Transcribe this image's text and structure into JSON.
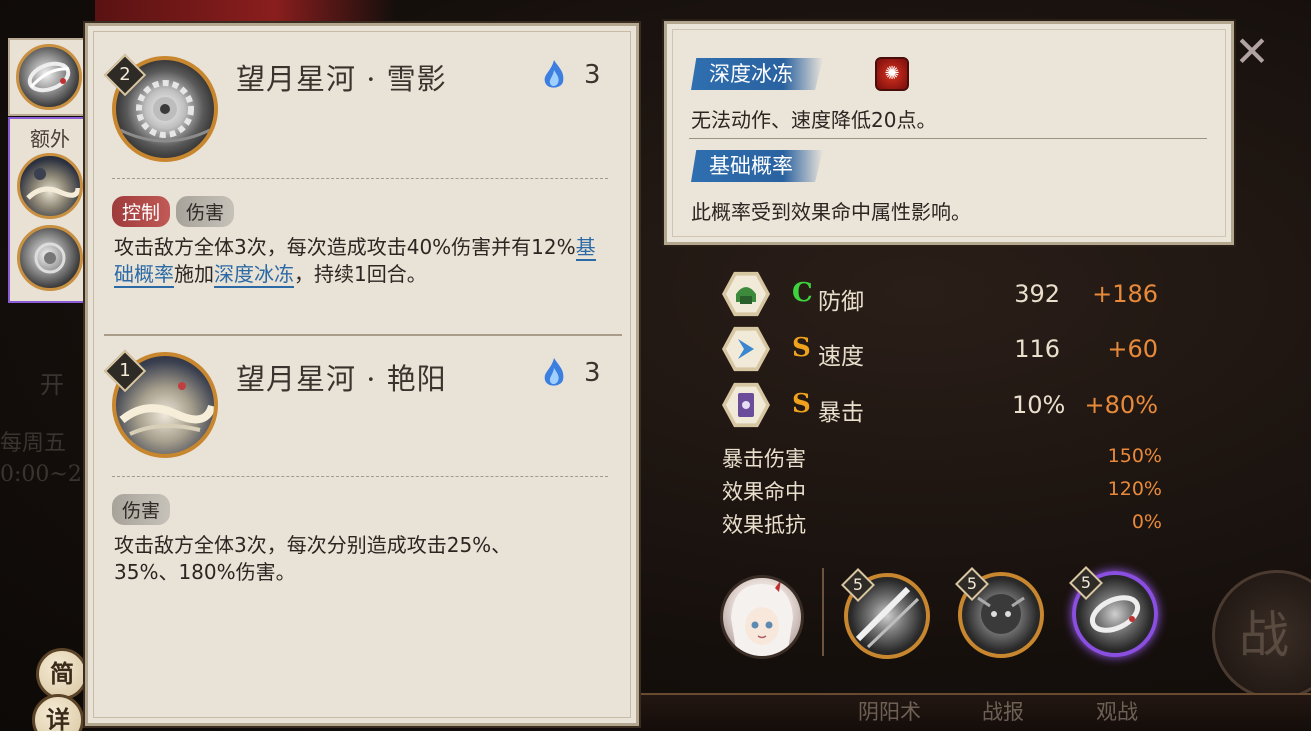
{
  "side_buttons": {
    "brief": "简",
    "detail": "详"
  },
  "thumbs": {
    "extra_label": "额外"
  },
  "skills": [
    {
      "level": "2",
      "name": "望月星河 · 雪影",
      "cost": "3",
      "tags": [
        "控制",
        "伤害"
      ],
      "desc_part1": "攻击敌方全体3次，每次造成攻击40%伤害并有12%",
      "kw1": "基础概率",
      "desc_part2": "施加",
      "kw2": "深度冰冻",
      "desc_part3": "，持续1回合。"
    },
    {
      "level": "1",
      "name": "望月星河 · 艳阳",
      "cost": "3",
      "tags": [
        "伤害"
      ],
      "desc": "攻击敌方全体3次，每次分别造成攻击25%、35%、180%伤害。"
    }
  ],
  "tooltip": {
    "section1_title": "深度冰冻",
    "section1_text": "无法动作、速度降低20点。",
    "section2_title": "基础概率",
    "section2_text": "此概率受到效果命中属性影响。"
  },
  "stats": [
    {
      "name": "防御",
      "grade": "C",
      "grade_color": "#3ed43e",
      "base": "392",
      "add": "+186",
      "icon": "helmet-icon"
    },
    {
      "name": "速度",
      "grade": "S",
      "grade_color": "#f0a21e",
      "base": "116",
      "add": "+60",
      "icon": "arrow-icon"
    },
    {
      "name": "暴击",
      "grade": "S",
      "grade_color": "#f0a21e",
      "base": "10%",
      "add": "+80%",
      "icon": "scroll-icon"
    }
  ],
  "sub_stats": [
    {
      "name": "暴击伤害",
      "value": "150%"
    },
    {
      "name": "效果命中",
      "value": "120%"
    },
    {
      "name": "效果抵抗",
      "value": "0%"
    }
  ],
  "souls": [
    {
      "level": "5"
    },
    {
      "level": "5"
    },
    {
      "level": "5"
    }
  ],
  "bottom_tabs": [
    "阴阳术",
    "战报",
    "观战"
  ],
  "background": {
    "left_text_1": "开",
    "left_text_2": "每周五",
    "left_text_3": "0:00~2",
    "battle": "战"
  },
  "colors": {
    "accent_blue": "#2c6aa5",
    "bonus_orange": "#e88a3a",
    "active_purple": "#8a4ee0"
  }
}
